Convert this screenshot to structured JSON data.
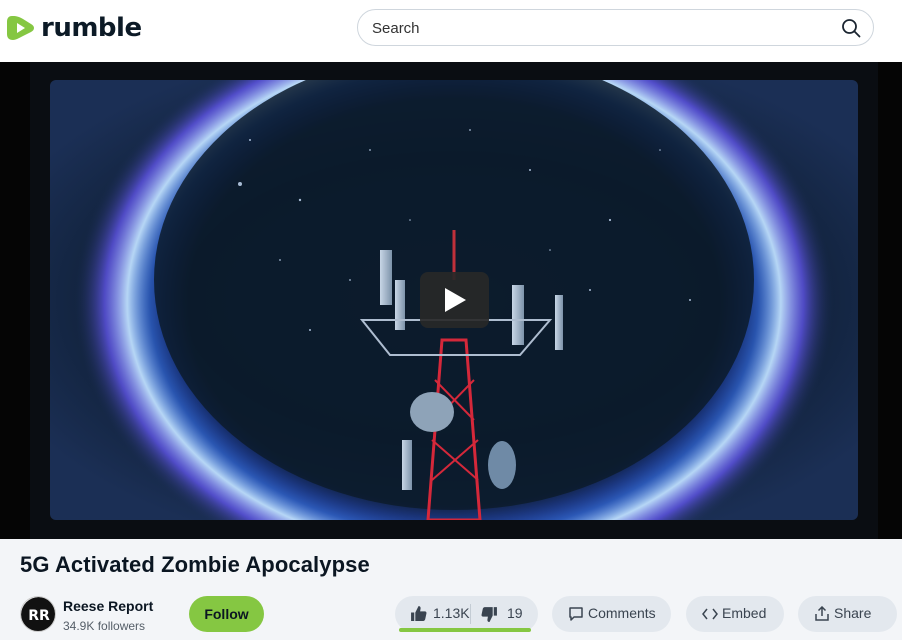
{
  "header": {
    "logo_text": "rumble",
    "search_placeholder": "Search"
  },
  "video": {
    "title": "5G Activated Zombie Apocalypse"
  },
  "channel": {
    "name": "Reese Report",
    "followers": "34.9K followers",
    "follow_label": "Follow"
  },
  "actions": {
    "likes": "1.13K",
    "dislikes": "19",
    "like_ratio": 0.98,
    "comments_label": "Comments",
    "embed_label": "Embed",
    "share_label": "Share"
  },
  "icons": {
    "logo": "rumble-play-logo-icon",
    "search": "search-icon",
    "play": "play-icon",
    "like": "thumbs-up-icon",
    "dislike": "thumbs-down-icon",
    "comments": "comment-icon",
    "embed": "code-icon",
    "share": "share-icon"
  },
  "colors": {
    "brand_green": "#85c742",
    "text_dark": "#0b1622"
  }
}
